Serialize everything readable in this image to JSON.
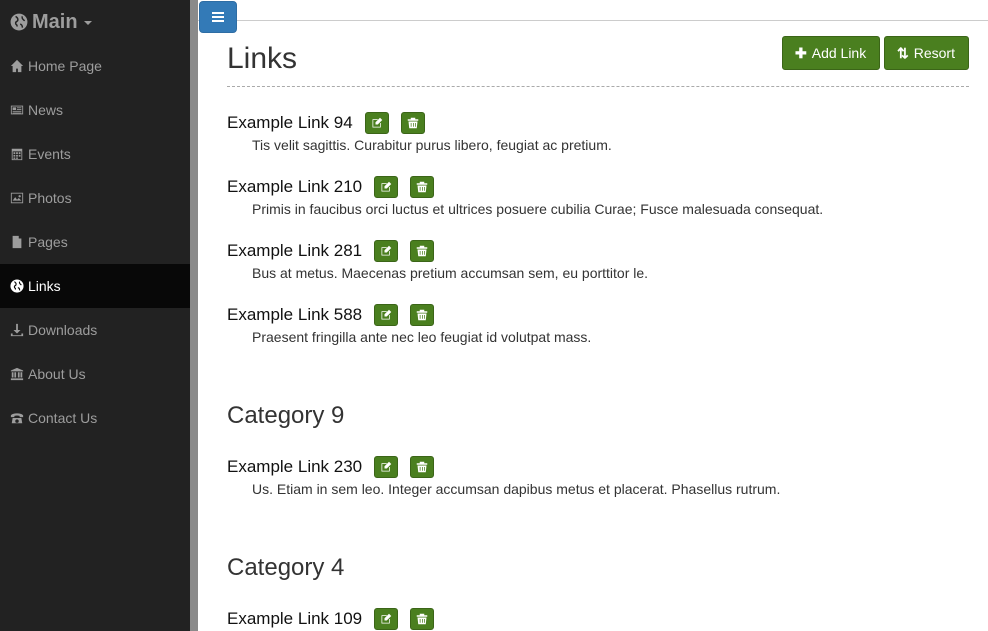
{
  "brand": {
    "label": "Main"
  },
  "sidebar": {
    "items": [
      {
        "label": "Home Page",
        "icon": "home-icon",
        "active": false
      },
      {
        "label": "News",
        "icon": "newspaper-icon",
        "active": false
      },
      {
        "label": "Events",
        "icon": "calendar-icon",
        "active": false
      },
      {
        "label": "Photos",
        "icon": "picture-icon",
        "active": false
      },
      {
        "label": "Pages",
        "icon": "file-icon",
        "active": false
      },
      {
        "label": "Links",
        "icon": "globe-icon",
        "active": true
      },
      {
        "label": "Downloads",
        "icon": "download-icon",
        "active": false
      },
      {
        "label": "About Us",
        "icon": "institution-icon",
        "active": false
      },
      {
        "label": "Contact Us",
        "icon": "phone-icon",
        "active": false
      }
    ]
  },
  "header": {
    "title": "Links",
    "add_label": "Add Link",
    "resort_label": "Resort"
  },
  "links": [
    {
      "title": "Example Link 94",
      "desc": "Tis velit sagittis. Curabitur purus libero, feugiat ac pretium."
    },
    {
      "title": "Example Link 210",
      "desc": "Primis in faucibus orci luctus et ultrices posuere cubilia Curae; Fusce malesuada consequat."
    },
    {
      "title": "Example Link 281",
      "desc": "Bus at metus. Maecenas pretium accumsan sem, eu porttitor le."
    },
    {
      "title": "Example Link 588",
      "desc": "Praesent fringilla ante nec leo feugiat id volutpat mass."
    }
  ],
  "categories": [
    {
      "title": "Category 9",
      "links": [
        {
          "title": "Example Link 230",
          "desc": "Us. Etiam in sem leo. Integer accumsan dapibus metus et placerat. Phasellus rutrum."
        }
      ]
    },
    {
      "title": "Category 4",
      "links": [
        {
          "title": "Example Link 109",
          "desc": ""
        }
      ]
    }
  ],
  "colors": {
    "sidebar_bg": "#222222",
    "active_bg": "#080808",
    "button_green": "#4a7f1f",
    "toggle_blue": "#337ab7"
  }
}
